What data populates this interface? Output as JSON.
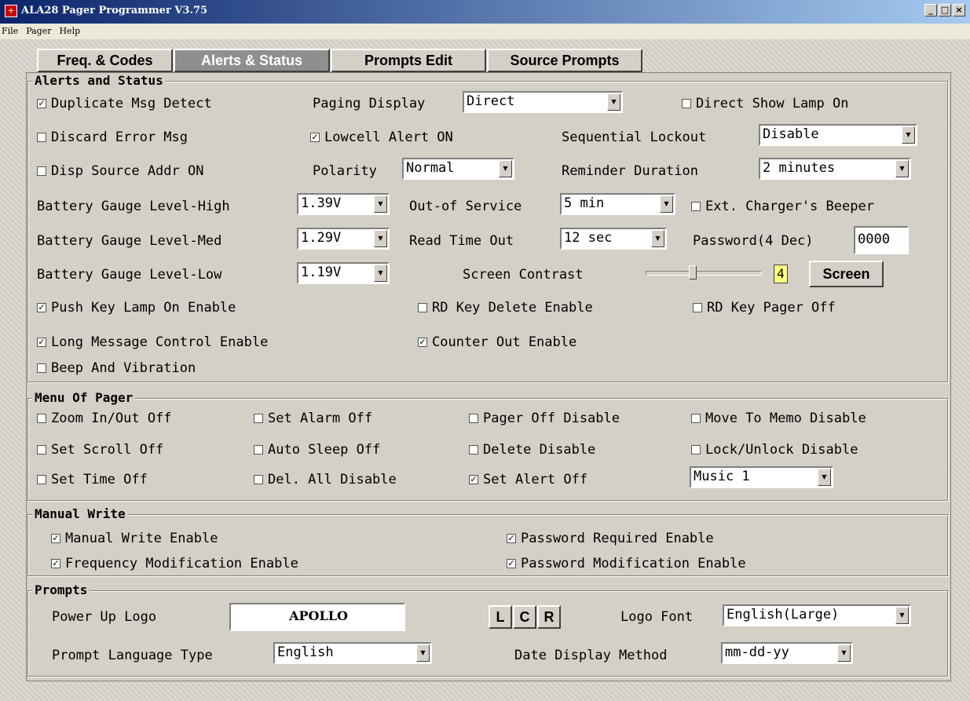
{
  "window": {
    "title": "ALA28 Pager Programmer V3.75",
    "minimize": "_",
    "maximize": "□",
    "close": "×"
  },
  "menu": [
    "File",
    "Pager",
    "Help"
  ],
  "tabs": [
    "Freq. & Codes",
    "Alerts & Status",
    "Prompts Edit",
    "Source Prompts"
  ],
  "alerts": {
    "group_title": "Alerts and Status",
    "duplicate": {
      "label": "Duplicate Msg Detect",
      "checked": true
    },
    "paging_display_label": "Paging Display",
    "paging_display_value": "Direct",
    "direct_show_lamp": {
      "label": "Direct Show Lamp On",
      "checked": false
    },
    "discard_error": {
      "label": "Discard Error Msg",
      "checked": false
    },
    "lowcell": {
      "label": "Lowcell Alert ON",
      "checked": true
    },
    "sequential_lockout_label": "Sequential Lockout",
    "sequential_lockout_value": "Disable",
    "disp_source": {
      "label": "Disp Source Addr ON",
      "checked": false
    },
    "polarity_label": "Polarity",
    "polarity_value": "Normal",
    "reminder_label": "Reminder Duration",
    "reminder_value": "2 minutes",
    "bat_high_label": "Battery Gauge Level-High",
    "bat_high_value": "1.39V",
    "out_of_service_label": "Out-of Service",
    "out_of_service_value": "5 min",
    "ext_charger": {
      "label": "Ext. Charger's Beeper",
      "checked": false
    },
    "bat_med_label": "Battery Gauge Level-Med",
    "bat_med_value": "1.29V",
    "read_timeout_label": "Read Time Out",
    "read_timeout_value": "12 sec",
    "password_label": "Password(4 Dec)",
    "password_value": "0000",
    "bat_low_label": "Battery Gauge Level-Low",
    "bat_low_value": "1.19V",
    "contrast_label": "Screen Contrast",
    "contrast_value": "4",
    "contrast_level": 0.4,
    "screen_button": "Screen",
    "push_key_lamp": {
      "label": "Push Key Lamp On Enable",
      "checked": true
    },
    "rd_key_delete": {
      "label": "RD Key Delete Enable",
      "checked": false
    },
    "rd_key_pager_off": {
      "label": "RD Key Pager Off",
      "checked": false
    },
    "long_message": {
      "label": "Long Message Control Enable",
      "checked": true
    },
    "counter_out": {
      "label": "Counter Out Enable",
      "checked": true
    },
    "beep_vibration": {
      "label": "Beep And Vibration",
      "checked": false
    }
  },
  "menu_of_pager": {
    "group_title": "Menu Of Pager",
    "zoom": {
      "label": "Zoom In/Out Off",
      "checked": false
    },
    "set_alarm": {
      "label": "Set Alarm Off",
      "checked": false
    },
    "pager_off": {
      "label": "Pager Off Disable",
      "checked": false
    },
    "move_memo": {
      "label": "Move To Memo Disable",
      "checked": false
    },
    "set_scroll": {
      "label": "Set Scroll Off",
      "checked": false
    },
    "auto_sleep": {
      "label": "Auto Sleep Off",
      "checked": false
    },
    "delete_disable": {
      "label": "Delete Disable",
      "checked": false
    },
    "lock_unlock": {
      "label": "Lock/Unlock Disable",
      "checked": false
    },
    "set_time": {
      "label": "Set Time Off",
      "checked": false
    },
    "del_all": {
      "label": "Del. All Disable",
      "checked": false
    },
    "set_alert": {
      "label": "Set Alert Off",
      "checked": true
    },
    "music_value": "Music 1"
  },
  "manual_write": {
    "group_title": "Manual Write",
    "manual_write_enable": {
      "label": "Manual Write Enable",
      "checked": true
    },
    "password_required": {
      "label": "Password Required Enable",
      "checked": true
    },
    "freq_mod": {
      "label": "Frequency Modification Enable",
      "checked": true
    },
    "password_mod": {
      "label": "Password Modification Enable",
      "checked": true
    }
  },
  "prompts": {
    "group_title": "Prompts",
    "power_up_logo_label": "Power Up Logo",
    "power_up_logo_value": "APOLLO",
    "align_l": "L",
    "align_c": "C",
    "align_r": "R",
    "logo_font_label": "Logo Font",
    "logo_font_value": "English(Large)",
    "prompt_lang_label": "Prompt Language Type",
    "prompt_lang_value": "English",
    "date_display_label": "Date Display Method",
    "date_display_value": "mm-dd-yy"
  },
  "glyphs": {
    "check": "✓",
    "dropdown": "▼"
  }
}
